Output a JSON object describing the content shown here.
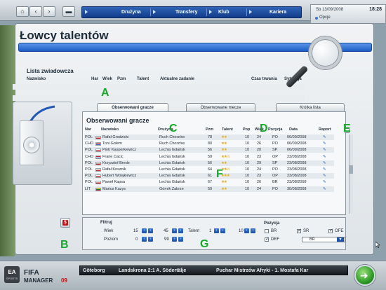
{
  "topbar": {
    "menu": [
      "Drużyna",
      "Transfery",
      "Klub",
      "Kariera"
    ],
    "date": "Sb 13/09/2008",
    "time": "18:28",
    "options": "Opcje"
  },
  "page": {
    "title": "Łowcy talentów"
  },
  "scouts": {
    "title": "Lista zwiadowcza",
    "columns": [
      "Nazwisko",
      "Har",
      "Wiek",
      "Pzm",
      "Talent",
      "Aktualne zadanie",
      "Czas trwania",
      "Sytuacja"
    ]
  },
  "annotations": {
    "A": "A",
    "B": "B",
    "C": "C",
    "D": "D",
    "E": "E",
    "F": "F",
    "G": "G"
  },
  "tabs": [
    "Obserwowani gracze",
    "Obserwowane mecze",
    "Krótka lista"
  ],
  "players": {
    "title": "Obserwowani gracze",
    "columns": [
      "Nar",
      "Nazwisko",
      "Drużyna",
      "Pzm",
      "Talent",
      "Pop",
      "Wiek",
      "Pozycja",
      "Data",
      "Raport"
    ],
    "rows": [
      {
        "nat": "POL",
        "name": "Rafał Grodzicki",
        "team": "Ruch Chorzów",
        "pzm": "78",
        "stars": "★★",
        "pop": "10",
        "age": "24",
        "pos": "PO",
        "date": "06/09/2008"
      },
      {
        "nat": "CHO",
        "name": "Toni Golem",
        "team": "Ruch Chorzów",
        "pzm": "80",
        "stars": "★★",
        "pop": "10",
        "age": "26",
        "pos": "PO",
        "date": "06/09/2008"
      },
      {
        "nat": "POL",
        "name": "Piotr Kasperkiewicz",
        "team": "Lechia Gdańsk",
        "pzm": "56",
        "stars": "★★",
        "pop": "10",
        "age": "20",
        "pos": "SP",
        "date": "06/09/2008"
      },
      {
        "nat": "CHO",
        "name": "Frane Cacic",
        "team": "Lechia Gdańsk",
        "pzm": "59",
        "stars": "★★½",
        "pop": "10",
        "age": "23",
        "pos": "OP",
        "date": "23/08/2008"
      },
      {
        "nat": "POL",
        "name": "Krzysztof Brede",
        "team": "Lechia Gdańsk",
        "pzm": "56",
        "stars": "★★",
        "pop": "10",
        "age": "29",
        "pos": "SP",
        "date": "23/08/2008"
      },
      {
        "nat": "POL",
        "name": "Rafał Kosznik",
        "team": "Lechia Gdańsk",
        "pzm": "64",
        "stars": "★★½",
        "pop": "10",
        "age": "24",
        "pos": "PO",
        "date": "23/08/2008"
      },
      {
        "nat": "POL",
        "name": "Hubert Wołąkiewicz",
        "team": "Lechia Gdańsk",
        "pzm": "61",
        "stars": "★★★",
        "pop": "10",
        "age": "23",
        "pos": "OP",
        "date": "23/08/2008"
      },
      {
        "nat": "POL",
        "name": "Paweł Kapsa",
        "team": "Lechia Gdańsk",
        "pzm": "67",
        "stars": "★★",
        "pop": "10",
        "age": "26",
        "pos": "BR",
        "date": "23/08/2008"
      },
      {
        "nat": "LIT",
        "name": "Marius Kazys",
        "team": "Górnik Zabrze",
        "pzm": "59",
        "stars": "★★",
        "pop": "10",
        "age": "24",
        "pos": "PO",
        "date": "30/08/2008"
      }
    ]
  },
  "filter": {
    "title": "Filtruj",
    "age_label": "Wiek",
    "age_min": "15",
    "age_max": "45",
    "talent_label": "Talent",
    "talent_min": "1",
    "talent_max": "10",
    "level_label": "Poziom",
    "level_min": "0",
    "level_max": "99",
    "position_label": "Pozycja",
    "positions": [
      "BR",
      "DEF",
      "ŚR",
      "OFE"
    ],
    "selected_position": "BR"
  },
  "bottom": {
    "logo_line1": "FIFA",
    "logo_line2": "MANAGER",
    "logo_num": "09",
    "ticker1": "Göteborg",
    "ticker2": "Landskrona 2:1 A. Södertälje",
    "ticker3": "Puchar Mistrzów Afryki - 1. Mostafa Kar"
  },
  "colors": {
    "accent": "#1d5ec5",
    "annotation": "#16a82a",
    "go": "#2f9b26"
  }
}
